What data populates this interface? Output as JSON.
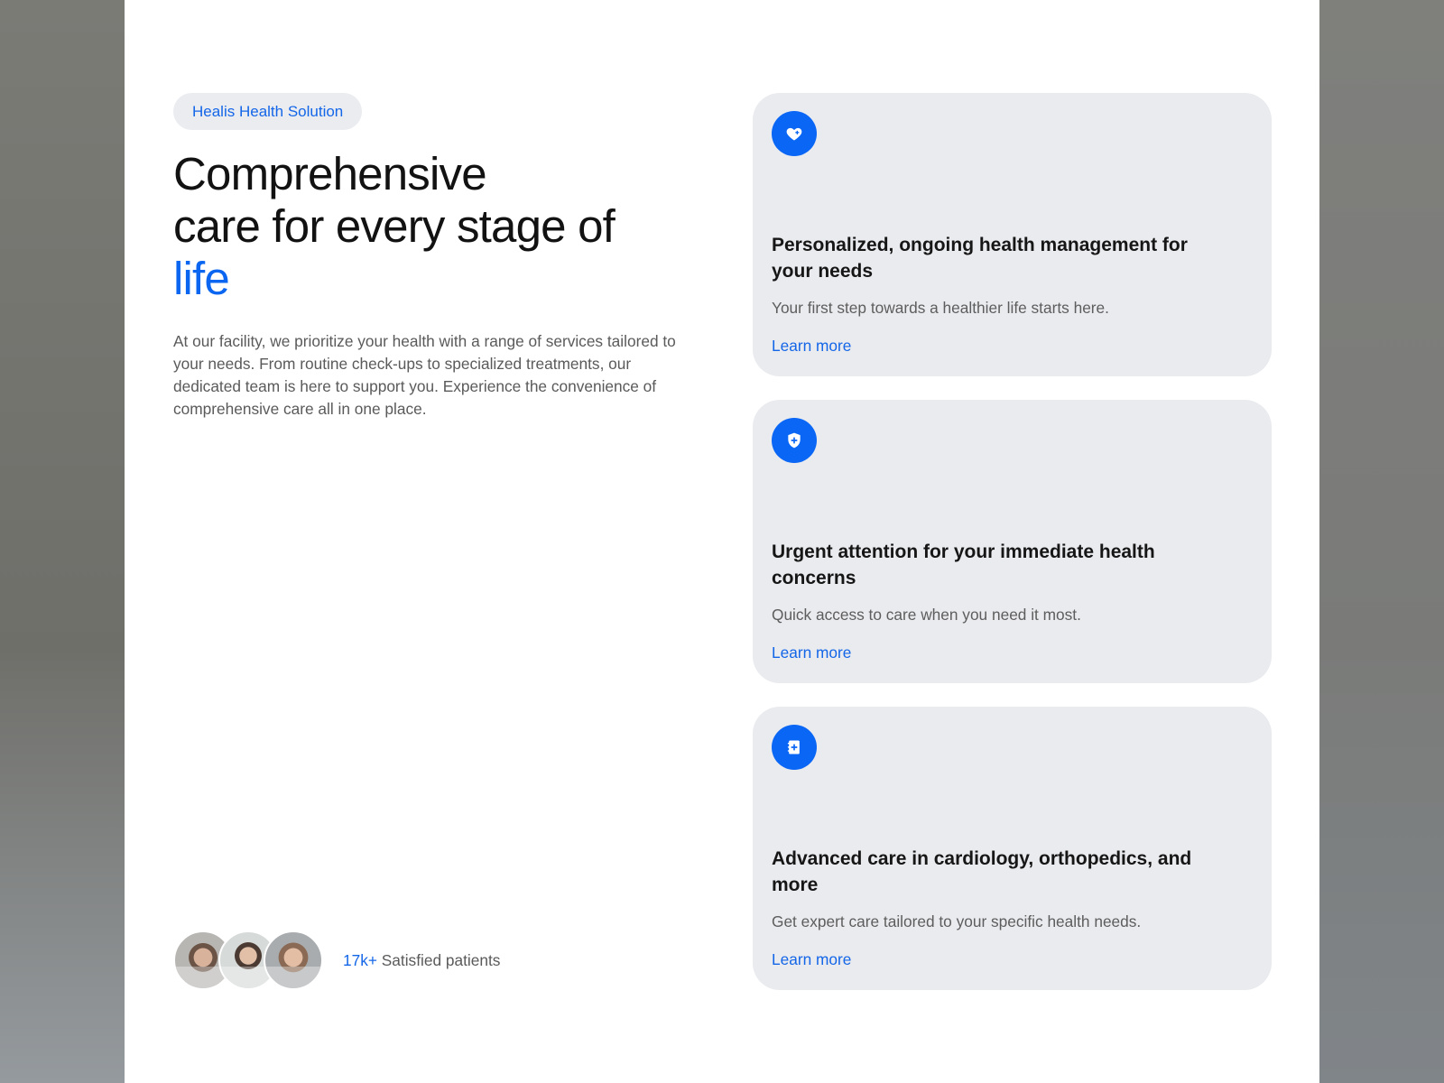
{
  "colors": {
    "accent": "#0a66f0",
    "pill_bg": "#eaecf0",
    "card_bg": "#eaebef",
    "heading": "#121212",
    "body_text": "#5a5a5a"
  },
  "hero": {
    "badge": "Healis Health Solution",
    "headline_line1": "Comprehensive",
    "headline_line2": "care for every stage of",
    "headline_accent": "life",
    "intro": "At our facility, we prioritize your health with a range of services tailored to your needs. From routine check-ups to specialized treatments, our dedicated team is here to support you. Experience the convenience of comprehensive care all in one place."
  },
  "patients": {
    "count": "17k+",
    "label": "Satisfied patients",
    "avatars": [
      "patient-avatar-1",
      "patient-avatar-2",
      "patient-avatar-3"
    ]
  },
  "cards": [
    {
      "icon": "heart-plus-icon",
      "title": "Personalized, ongoing health management for your needs",
      "description": "Your first step towards a healthier life starts here.",
      "link": "Learn more"
    },
    {
      "icon": "shield-plus-icon",
      "title": "Urgent attention for your immediate health concerns",
      "description": "Quick access to care when you need it most.",
      "link": "Learn more"
    },
    {
      "icon": "medical-notebook-icon",
      "title": "Advanced care in cardiology, orthopedics, and more",
      "description": "Get expert care tailored to your specific health needs.",
      "link": "Learn more"
    }
  ]
}
